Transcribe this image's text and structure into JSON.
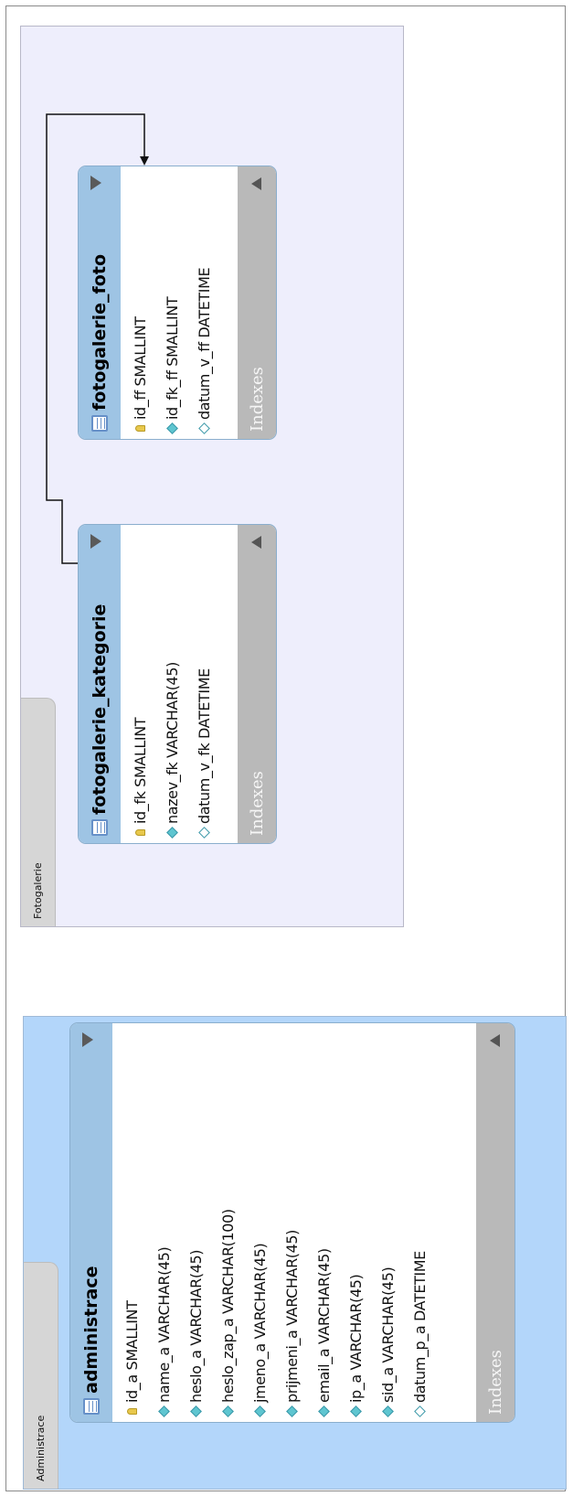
{
  "layers": {
    "fotogalerie": {
      "tab_label": "Fotogalerie"
    },
    "administrace": {
      "tab_label": "Administrace"
    }
  },
  "tables": {
    "fotogalerie_foto": {
      "name": "fotogalerie_foto",
      "columns": [
        {
          "icon": "primary-key-icon",
          "text": "id_ff SMALLINT"
        },
        {
          "icon": "column-diamond-filled-icon",
          "text": "id_fk_ff SMALLINT"
        },
        {
          "icon": "column-diamond-empty-icon",
          "text": "datum_v_ff DATETIME"
        }
      ],
      "indexes_label": "Indexes"
    },
    "fotogalerie_kategorie": {
      "name": "fotogalerie_kategorie",
      "columns": [
        {
          "icon": "primary-key-icon",
          "text": "id_fk SMALLINT"
        },
        {
          "icon": "column-diamond-filled-icon",
          "text": "nazev_fk VARCHAR(45)"
        },
        {
          "icon": "column-diamond-empty-icon",
          "text": "datum_v_fk DATETIME"
        }
      ],
      "indexes_label": "Indexes"
    },
    "administrace": {
      "name": "administrace",
      "columns": [
        {
          "icon": "primary-key-icon",
          "text": "id_a SMALLINT"
        },
        {
          "icon": "column-diamond-filled-icon",
          "text": "name_a VARCHAR(45)"
        },
        {
          "icon": "column-diamond-filled-icon",
          "text": "heslo_a VARCHAR(45)"
        },
        {
          "icon": "column-diamond-filled-icon",
          "text": "heslo_zap_a VARCHAR(100)"
        },
        {
          "icon": "column-diamond-filled-icon",
          "text": "jmeno_a VARCHAR(45)"
        },
        {
          "icon": "column-diamond-filled-icon",
          "text": "prijmeni_a VARCHAR(45)"
        },
        {
          "icon": "column-diamond-filled-icon",
          "text": "email_a VARCHAR(45)"
        },
        {
          "icon": "column-diamond-filled-icon",
          "text": "ip_a VARCHAR(45)"
        },
        {
          "icon": "column-diamond-filled-icon",
          "text": "sid_a VARCHAR(45)"
        },
        {
          "icon": "column-diamond-empty-icon",
          "text": "datum_p_a DATETIME"
        }
      ],
      "indexes_label": "Indexes"
    }
  },
  "relationships": [
    {
      "from": "fotogalerie_kategorie",
      "to": "fotogalerie_foto"
    }
  ],
  "colors": {
    "fotogalerie_layer": "#eeeefc",
    "administrace_layer": "#b3d6fa",
    "table_header": "#9ec4e4",
    "indexes_bar": "#b9b9b9"
  }
}
